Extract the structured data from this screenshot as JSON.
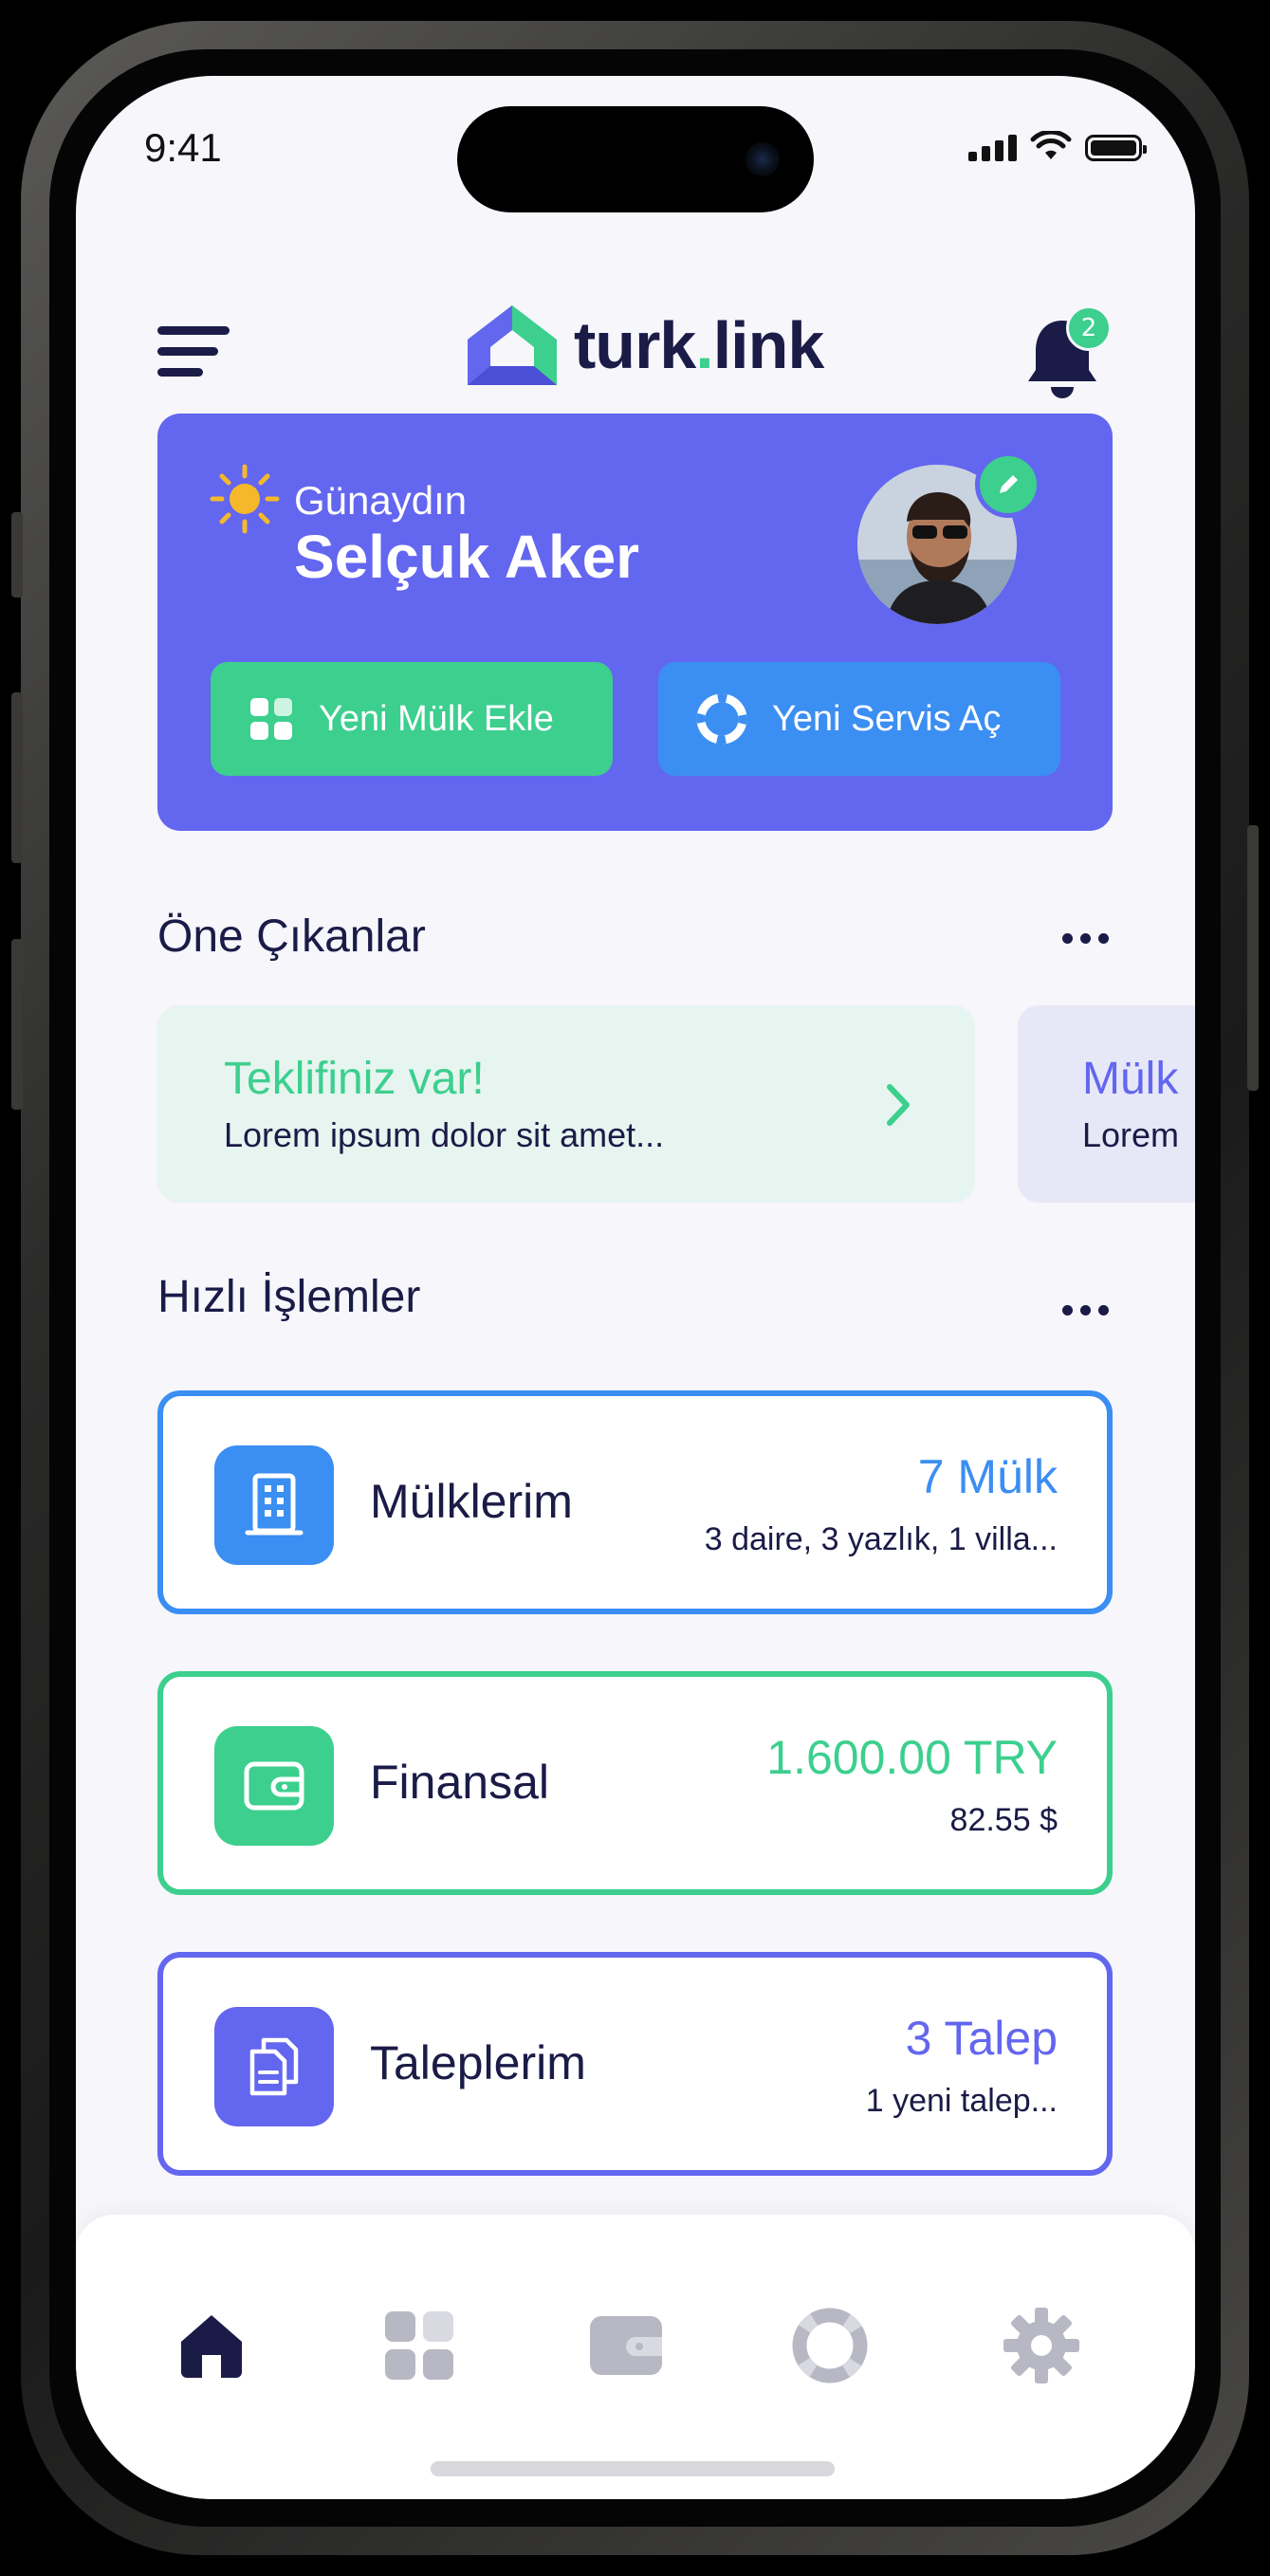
{
  "status_bar": {
    "time": "9:41"
  },
  "header": {
    "logo_text_main": "turk",
    "logo_text_dot": ".",
    "logo_text_end": "link",
    "notification_count": "2"
  },
  "hero": {
    "greeting": "Günaydın",
    "user_name": "Selçuk Aker",
    "add_property_label": "Yeni Mülk Ekle",
    "new_service_label": "Yeni Servis Aç"
  },
  "highlights": {
    "title": "Öne Çıkanlar",
    "cards": [
      {
        "title": "Teklifiniz var!",
        "description": "Lorem ipsum dolor sit amet..."
      },
      {
        "title": "Mülk",
        "description": "Lorem"
      }
    ]
  },
  "quick_actions": {
    "title": "Hızlı İşlemler",
    "items": [
      {
        "title": "Mülklerim",
        "value": "7 Mülk",
        "subtitle": "3 daire, 3 yazlık, 1 villa..."
      },
      {
        "title": "Finansal",
        "value": "1.600.00 TRY",
        "subtitle": "82.55 $"
      },
      {
        "title": "Taleplerim",
        "value": "3 Talep",
        "subtitle": "1 yeni talep..."
      }
    ]
  },
  "tabbar": {
    "items": [
      "home-icon",
      "grid-icon",
      "wallet-icon",
      "lifebuoy-icon",
      "gear-icon"
    ]
  },
  "colors": {
    "primary": "#6366ef",
    "green": "#3ccf8e",
    "blue": "#3b8ef2",
    "navy": "#1b1b47",
    "inactive": "#b7b8c4"
  }
}
